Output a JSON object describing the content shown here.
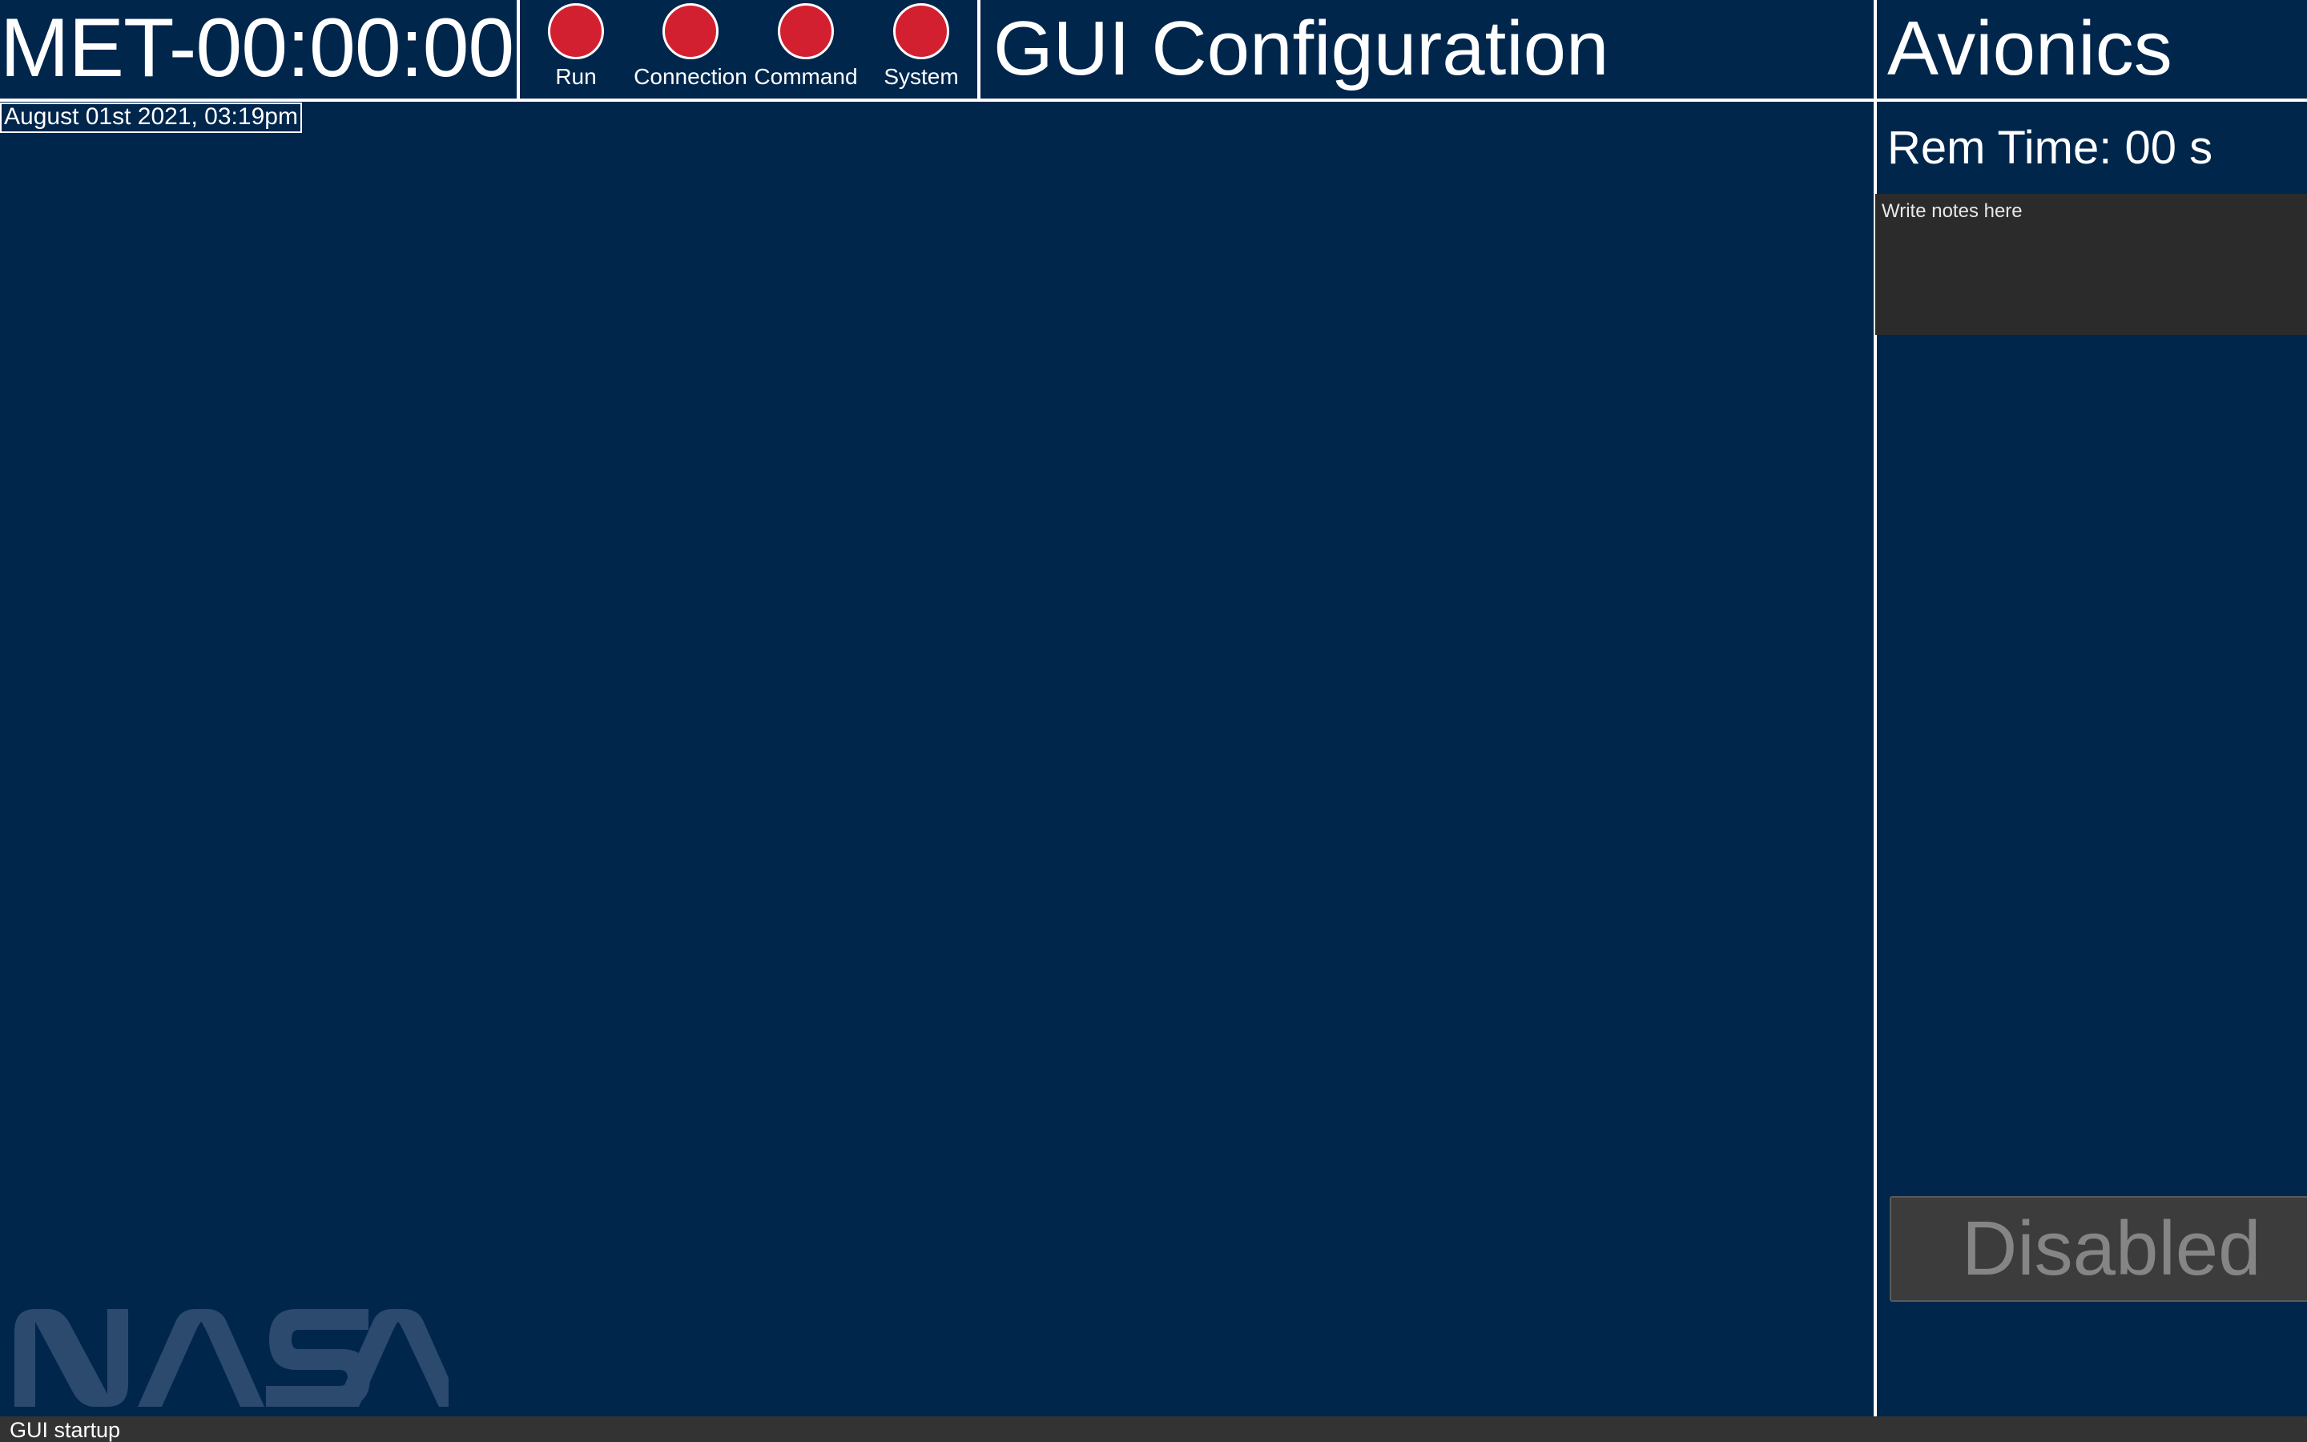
{
  "header": {
    "met_clock": "MET-00:00:00",
    "datetime": "August 01st 2021, 03:19pm",
    "page_title": "GUI Configuration",
    "panel_title": "Avionics"
  },
  "indicators": [
    {
      "label": "Run",
      "color": "#d32030"
    },
    {
      "label": "Connection",
      "color": "#d32030"
    },
    {
      "label": "Command",
      "color": "#d32030"
    },
    {
      "label": "System",
      "color": "#d32030"
    }
  ],
  "side_panel": {
    "rem_time_label": "Rem Time:",
    "rem_time_value": "00 s",
    "notes_placeholder": "Write notes here",
    "notes_value": "",
    "action_button_label": "Disabled",
    "action_button_enabled": false
  },
  "logo": {
    "text": "NASA",
    "icon": "nasa-worm-logo"
  },
  "status_bar": {
    "message": "GUI startup"
  },
  "colors": {
    "background": "#00264c",
    "indicator_off": "#d32030",
    "notes_background": "#2b2b2b",
    "status_bar": "#333333",
    "disabled_button": "#3c3c3c",
    "disabled_text": "#858585",
    "logo": "#2c4a6e"
  }
}
